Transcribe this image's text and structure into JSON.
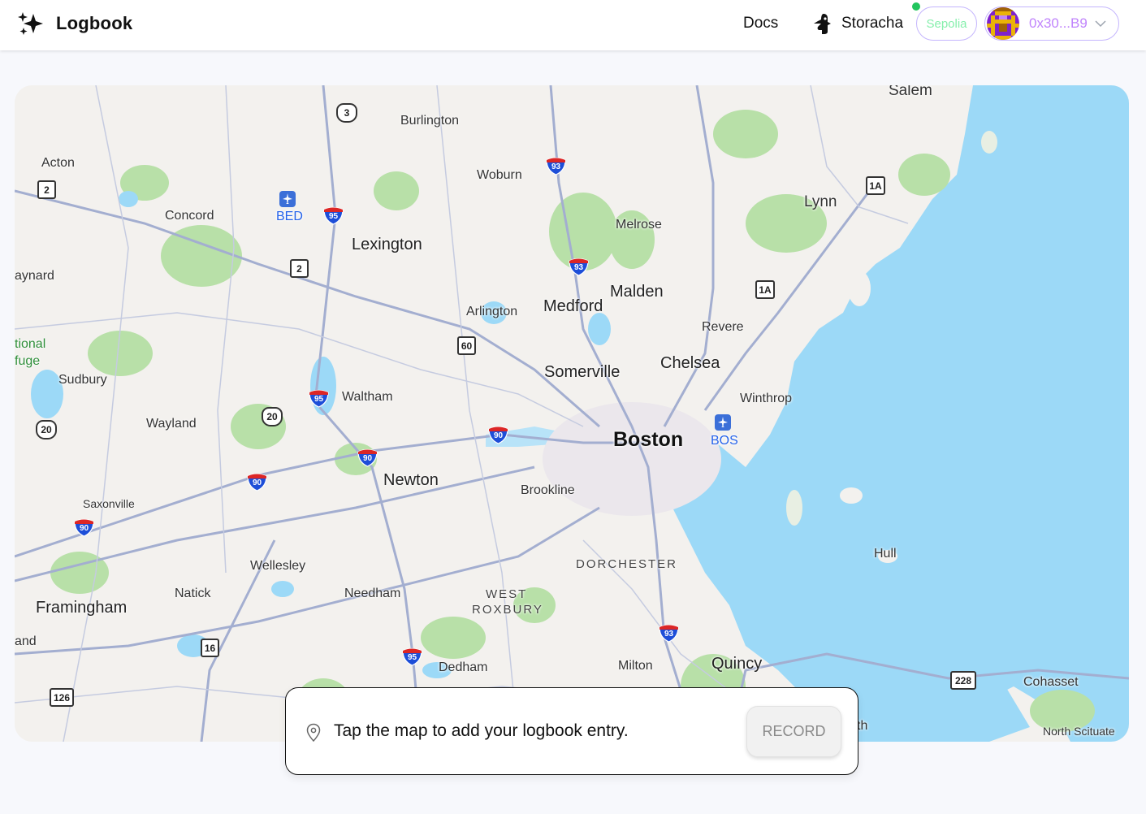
{
  "header": {
    "brand_title": "Logbook",
    "nav_docs": "Docs",
    "nav_storacha": "Storacha",
    "network_label": "Sepolia",
    "account_address": "0x30...B9",
    "icons": [
      "sparkles-icon",
      "storacha-icon",
      "chevron-down-icon"
    ]
  },
  "colors": {
    "water": "#9cd9f7",
    "land": "#f3f1ee",
    "park": "#b8e0a8",
    "network_text": "#86efac",
    "account_text": "#c084fc",
    "pill_border": "#c4b5fd",
    "status_dot": "#22c55e"
  },
  "map": {
    "labels": {
      "salem": "Salem",
      "burlington": "Burlington",
      "acton": "Acton",
      "woburn": "Woburn",
      "lynn": "Lynn",
      "concord": "Concord",
      "bed": "BED",
      "melrose": "Melrose",
      "lexington": "Lexington",
      "maynard": "aynard",
      "malden": "Malden",
      "arlington": "Arlington",
      "medford": "Medford",
      "revere": "Revere",
      "refuge_line1": "tional",
      "refuge_line2": "fuge",
      "chelsea": "Chelsea",
      "somerville": "Somerville",
      "sudbury": "Sudbury",
      "waltham": "Waltham",
      "winthrop": "Winthrop",
      "wayland": "Wayland",
      "boston": "Boston",
      "bos": "BOS",
      "newton": "Newton",
      "brookline": "Brookline",
      "saxonville": "Saxonville",
      "hull": "Hull",
      "dorchester": "DORCHESTER",
      "wellesley": "Wellesley",
      "natick": "Natick",
      "needham": "Needham",
      "west_roxbury_line1": "WEST",
      "west_roxbury_line2": "ROXBURY",
      "framingham": "Framingham",
      "land_edge": "and",
      "dedham": "Dedham",
      "milton": "Milton",
      "quincy": "Quincy",
      "cohasset": "Cohasset",
      "north_scituate": "North Scituate",
      "th_fragment": "th"
    },
    "shields": {
      "us3": "3",
      "i93_north": "93",
      "i93_mid": "93",
      "i93_south": "93",
      "i95_north": "95",
      "i95_mid": "95",
      "i95_south": "95",
      "i90_a": "90",
      "i90_b": "90",
      "i90_c": "90",
      "i90_d": "90",
      "r2_west": "2",
      "r2_mid": "2",
      "r1a_north": "1A",
      "r1a_south": "1A",
      "r60": "60",
      "us20_west": "20",
      "us20_mid": "20",
      "r16": "16",
      "r126": "126",
      "r228": "228"
    }
  },
  "entry": {
    "prompt": "Tap the map to add your logbook entry.",
    "record_label": "RECORD"
  }
}
